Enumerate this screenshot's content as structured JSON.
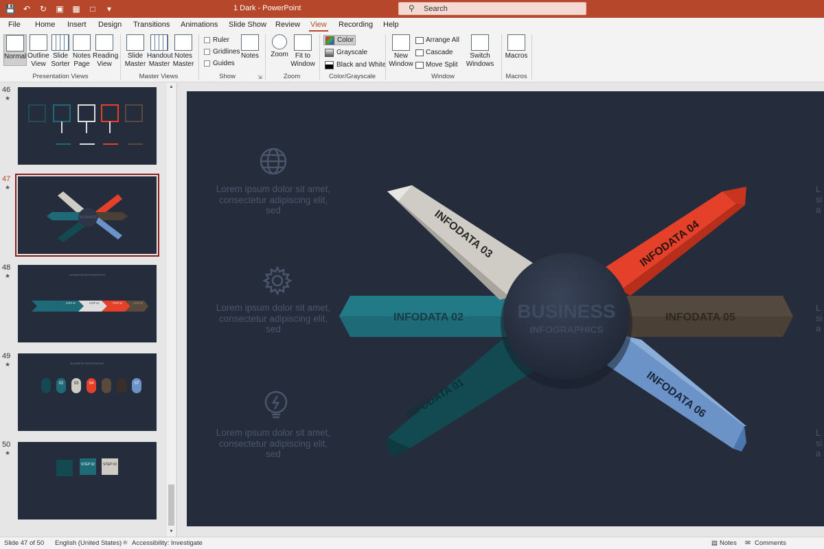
{
  "titlebar": {
    "doc_title": "1 Dark  -  PowerPoint",
    "search_label": "Search",
    "qat": [
      "save-icon",
      "undo-icon",
      "redo-icon",
      "present-icon",
      "picture-icon",
      "shape-icon",
      "more-icon"
    ]
  },
  "tabs": [
    "File",
    "Home",
    "Insert",
    "Design",
    "Transitions",
    "Animations",
    "Slide Show",
    "Review",
    "View",
    "Recording",
    "Help"
  ],
  "active_tab": "View",
  "ribbon": {
    "presentation_views": {
      "label": "Presentation Views",
      "normal": "Normal",
      "outline": "Outline View",
      "sorter": "Slide Sorter",
      "notes_page": "Notes Page",
      "reading": "Reading View"
    },
    "master_views": {
      "label": "Master Views",
      "slide_master": "Slide Master",
      "handout_master": "Handout Master",
      "notes_master": "Notes Master"
    },
    "show": {
      "label": "Show",
      "ruler": "Ruler",
      "gridlines": "Gridlines",
      "guides": "Guides",
      "notes": "Notes"
    },
    "zoom": {
      "label": "Zoom",
      "zoom": "Zoom",
      "fit": "Fit to Window"
    },
    "color": {
      "label": "Color/Grayscale",
      "color": "Color",
      "grayscale": "Grayscale",
      "bw": "Black and White"
    },
    "window": {
      "label": "Window",
      "new_window": "New Window",
      "arrange_all": "Arrange All",
      "cascade": "Cascade",
      "move_split": "Move Split",
      "switch": "Switch Windows"
    },
    "macros": {
      "label": "Macros",
      "macros": "Macros"
    }
  },
  "thumbnails": [
    {
      "num": "46",
      "star": "★"
    },
    {
      "num": "47",
      "star": "★"
    },
    {
      "num": "48",
      "star": "★"
    },
    {
      "num": "49",
      "star": "★"
    },
    {
      "num": "50",
      "star": "★"
    }
  ],
  "current_slide": "47",
  "thumb_texts": {
    "t48_title": "BUSINESS INFOGRAPHICS",
    "t49_title": "BUSINESS INFOGRAPHIC",
    "t48_step1": "STEP 02",
    "t48_step2": "STEP 03",
    "t48_step3": "STEP 04",
    "t48_step4": "STEP 05",
    "t49_n1": "02",
    "t49_n2": "03",
    "t49_n3": "04",
    "t49_n4": "07",
    "t50_step1": "STEP 02",
    "t50_step2": "STEP 03",
    "t47_center": "BUSINESS"
  },
  "slide": {
    "center_title": "BUSINESS",
    "center_subtitle": "INFOGRAPHICS",
    "lorem": "Lorem ipsum dolor sit amet, consectetur adipiscing elit, sed",
    "arrows": [
      "INFODATA 01",
      "INFODATA 02",
      "INFODATA 03",
      "INFODATA 04",
      "INFODATA 05",
      "INFODATA 06"
    ],
    "colors": {
      "bg": "#252d3c",
      "teal": "#1e6b77",
      "dark_teal": "#134a52",
      "light": "#cfccc6",
      "red": "#e5412a",
      "brown": "#4a4036",
      "blue": "#6b93c7"
    }
  },
  "statusbar": {
    "slide_info": "Slide 47 of 50",
    "language": "English (United States)",
    "accessibility": "Accessibility: Investigate",
    "notes": "Notes",
    "comments": "Comments"
  }
}
